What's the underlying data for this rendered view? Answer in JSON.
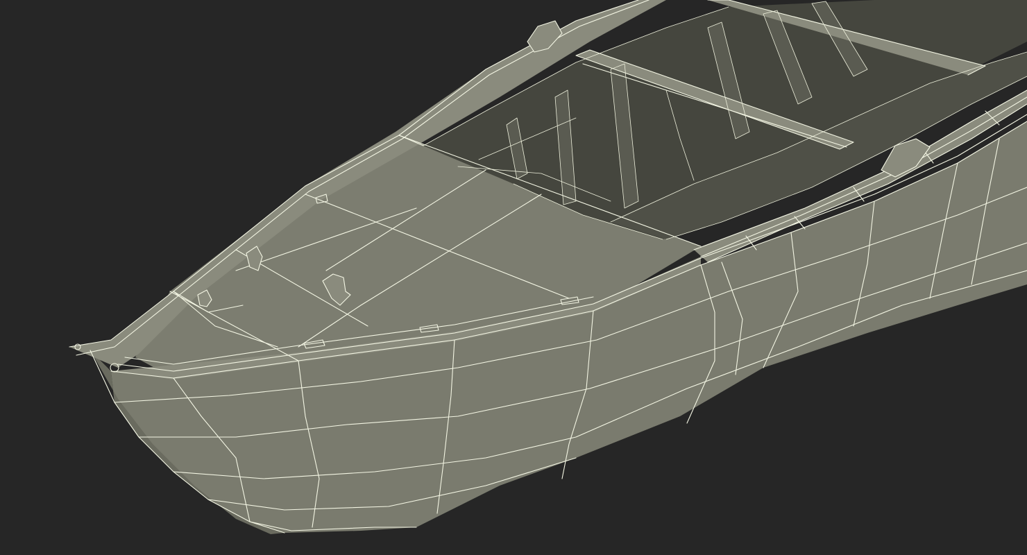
{
  "scene": {
    "background_color": "#262626",
    "subject": "wireframe-boat-bow",
    "hull_color": "#7a7b6e",
    "interior_color": "#4f5047",
    "wire_color": "#f4f6e4"
  }
}
